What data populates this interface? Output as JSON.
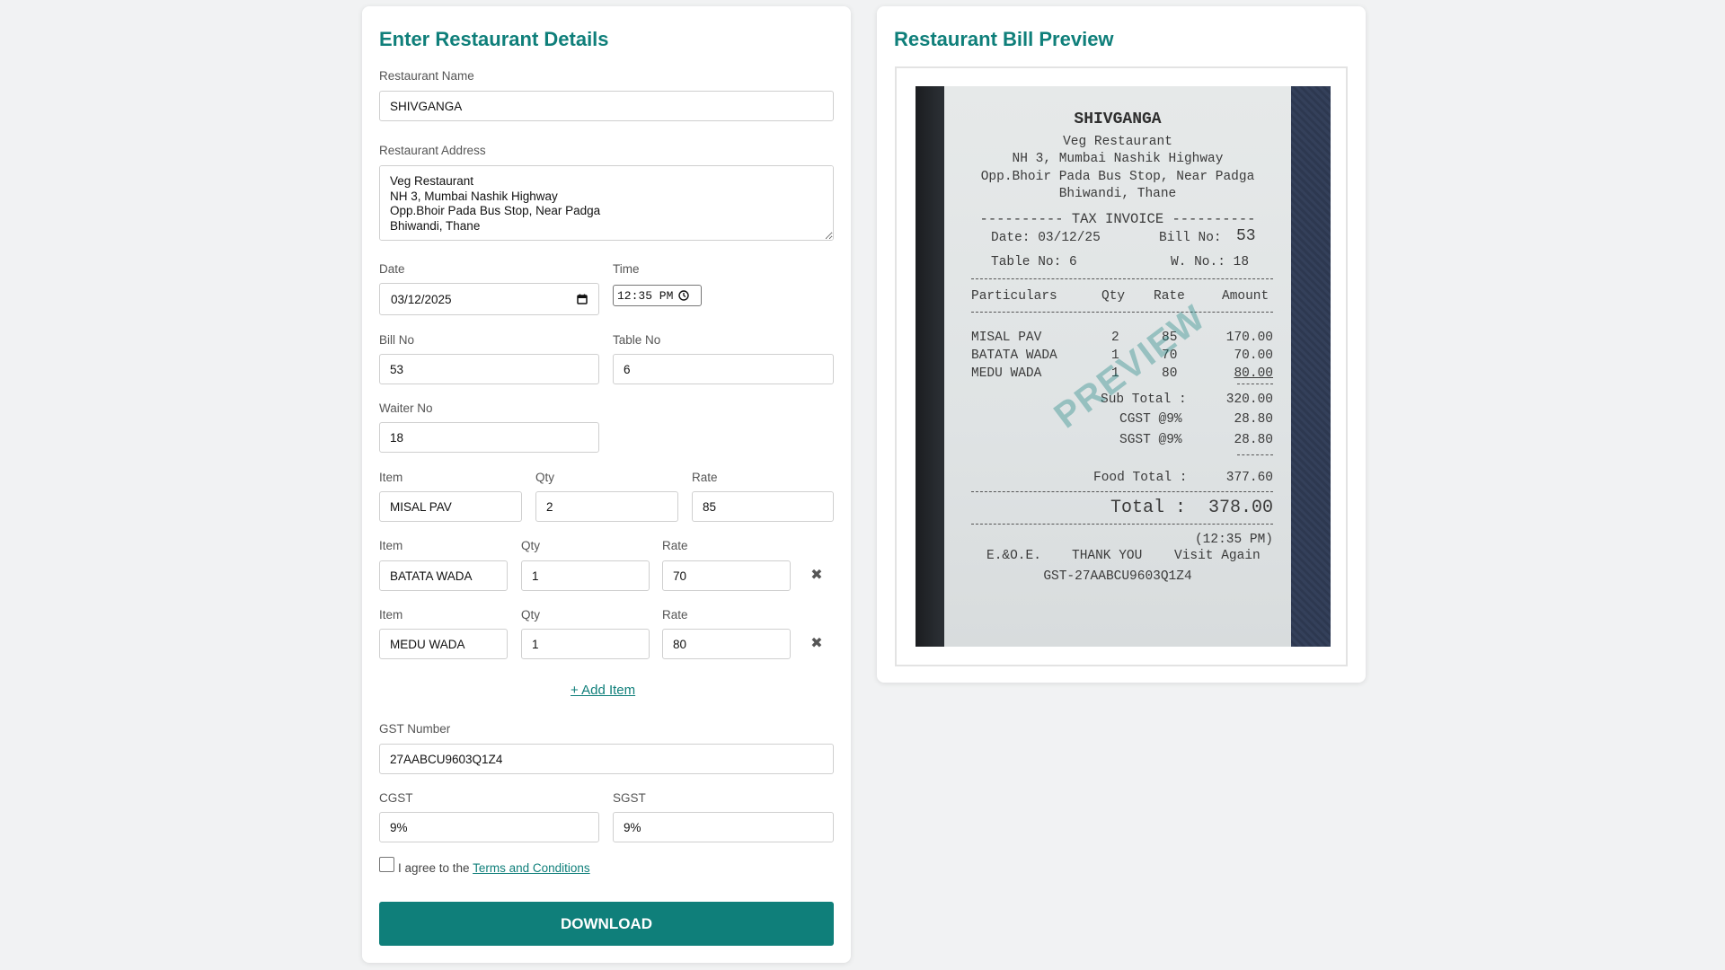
{
  "form": {
    "title": "Enter Restaurant Details",
    "restaurant_name_label": "Restaurant Name",
    "restaurant_name": "SHIVGANGA",
    "address_label": "Restaurant Address",
    "address": "Veg Restaurant\nNH 3, Mumbai Nashik Highway\nOpp.Bhoir Pada Bus Stop, Near Padga\nBhiwandi, Thane",
    "date_label": "Date",
    "date": "03/12/2025",
    "time_label": "Time",
    "time": "12:35 PM",
    "bill_no_label": "Bill No",
    "bill_no": "53",
    "table_no_label": "Table No",
    "table_no": "6",
    "waiter_no_label": "Waiter No",
    "waiter_no": "18",
    "item_label": "Item",
    "qty_label": "Qty",
    "rate_label": "Rate",
    "items": [
      {
        "name": "MISAL PAV",
        "qty": "2",
        "rate": "85"
      },
      {
        "name": "BATATA WADA",
        "qty": "1",
        "rate": "70"
      },
      {
        "name": "MEDU WADA",
        "qty": "1",
        "rate": "80"
      }
    ],
    "remove_glyph": "✖",
    "add_item": "+ Add Item",
    "gst_label": "GST Number",
    "gst": "27AABCU9603Q1Z4",
    "cgst_label": "CGST",
    "cgst": "9%",
    "sgst_label": "SGST",
    "sgst": "9%",
    "agree_text": "I agree to the",
    "terms_link": "Terms and Conditions",
    "download": "DOWNLOAD"
  },
  "preview": {
    "title": "Restaurant Bill Preview",
    "watermark": "PREVIEW",
    "receipt": {
      "name": "SHIVGANGA",
      "line1": "Veg Restaurant",
      "line2": "NH 3, Mumbai Nashik Highway",
      "line3": "Opp.Bhoir Pada Bus Stop, Near Padga",
      "line4": "Bhiwandi, Thane",
      "invoice": "---------- TAX INVOICE ----------",
      "date": "Date: 03/12/25",
      "bill_label": "Bill No:",
      "bill_no": "53",
      "table": "Table No: 6",
      "waiter": "W. No.: 18",
      "col_particulars": "Particulars",
      "col_qty": "Qty",
      "col_rate": "Rate",
      "col_amount": "Amount",
      "rows": [
        {
          "name": "MISAL PAV",
          "qty": "2",
          "rate": "85",
          "amount": "170.00"
        },
        {
          "name": "BATATA WADA",
          "qty": "1",
          "rate": "70",
          "amount": "70.00"
        },
        {
          "name": "MEDU WADA",
          "qty": "1",
          "rate": "80",
          "amount": "80.00"
        }
      ],
      "subtotal_label": "Sub Total :",
      "subtotal": "320.00",
      "cgst_label": "CGST @9%",
      "cgst": "28.80",
      "sgst_label": "SGST @9%",
      "sgst": "28.80",
      "food_total_label": "Food Total :",
      "food_total": "377.60",
      "total_label": "Total :",
      "total": "378.00",
      "time": "(12:35 PM)",
      "eoe": "E.&O.E.",
      "thanks": "THANK YOU",
      "visit": "Visit Again",
      "gst": "GST-27AABCU9603Q1Z4"
    }
  }
}
